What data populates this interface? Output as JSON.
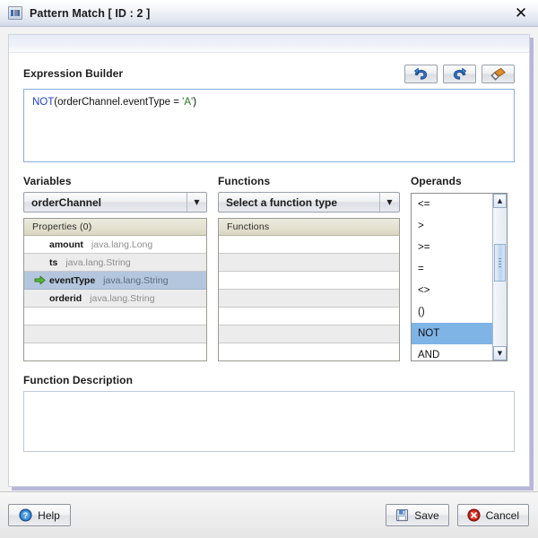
{
  "window": {
    "title": "Pattern Match [ ID : 2 ]",
    "icon": "pattern-match-icon",
    "close_label": "✕"
  },
  "expression_builder": {
    "label": "Expression Builder",
    "toolbar": [
      {
        "name": "undo-button",
        "label": "Undo"
      },
      {
        "name": "redo-button",
        "label": "Redo"
      },
      {
        "name": "clear-button",
        "label": "Clear"
      }
    ],
    "expression": "NOT(orderChannel.eventType = 'A')",
    "tokens": [
      {
        "text": "NOT",
        "kind": "keyword"
      },
      {
        "text": "(orderChannel.eventType = ",
        "kind": "plain"
      },
      {
        "text": "'A'",
        "kind": "string"
      },
      {
        "text": ")",
        "kind": "plain"
      }
    ]
  },
  "variables": {
    "label": "Variables",
    "selected": "orderChannel",
    "options": [
      "orderChannel"
    ],
    "table": {
      "header": "Properties (0)",
      "rows": [
        {
          "name": "amount",
          "type": "java.lang.Long",
          "selected": false
        },
        {
          "name": "ts",
          "type": "java.lang.String",
          "selected": false
        },
        {
          "name": "eventType",
          "type": "java.lang.String",
          "selected": true
        },
        {
          "name": "orderid",
          "type": "java.lang.String",
          "selected": false
        },
        {
          "name": "",
          "type": "",
          "selected": false
        },
        {
          "name": "",
          "type": "",
          "selected": false
        },
        {
          "name": "",
          "type": "",
          "selected": false
        }
      ]
    }
  },
  "functions": {
    "label": "Functions",
    "selected": "Select a function type",
    "options": [
      "Select a function type"
    ],
    "table": {
      "header": "Functions",
      "rows": [
        {
          "name": "",
          "type": "",
          "selected": false
        },
        {
          "name": "",
          "type": "",
          "selected": false
        },
        {
          "name": "",
          "type": "",
          "selected": false
        },
        {
          "name": "",
          "type": "",
          "selected": false
        },
        {
          "name": "",
          "type": "",
          "selected": false
        },
        {
          "name": "",
          "type": "",
          "selected": false
        },
        {
          "name": "",
          "type": "",
          "selected": false
        }
      ]
    }
  },
  "operands": {
    "label": "Operands",
    "items": [
      {
        "label": "<=",
        "selected": false
      },
      {
        "label": ">",
        "selected": false
      },
      {
        "label": ">=",
        "selected": false
      },
      {
        "label": "=",
        "selected": false
      },
      {
        "label": "<>",
        "selected": false
      },
      {
        "label": "()",
        "selected": false
      },
      {
        "label": "NOT",
        "selected": true
      },
      {
        "label": "AND",
        "selected": false
      }
    ],
    "scroll": {
      "up": "▲",
      "down": "▼"
    }
  },
  "function_description": {
    "label": "Function Description",
    "value": ""
  },
  "footer": {
    "help_label": "Help",
    "save_label": "Save",
    "cancel_label": "Cancel"
  },
  "colors": {
    "accent_blue": "#7fb4e6",
    "keyword_blue": "#1f3fd0",
    "string_green": "#1f7a1f",
    "row_selected": "#b3c6dd",
    "header_tan": "#e4e1d0",
    "shadow_lavender": "#b8b6d8"
  }
}
